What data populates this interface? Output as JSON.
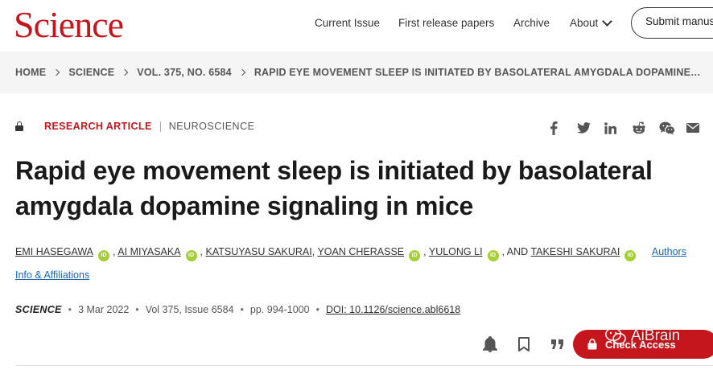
{
  "header": {
    "logo": "Science",
    "nav": [
      "Current Issue",
      "First release papers",
      "Archive",
      "About"
    ],
    "submit_label": "Submit manus"
  },
  "breadcrumb": [
    "HOME",
    "SCIENCE",
    "VOL. 375, NO. 6584",
    "RAPID EYE MOVEMENT SLEEP IS INITIATED BY BASOLATERAL AMYGDALA DOPAMINE…"
  ],
  "article": {
    "type": "RESEARCH ARTICLE",
    "subject": "NEUROSCIENCE",
    "title_line1": "Rapid eye movement sleep is initiated by basolateral",
    "title_line2": "amygdala dopamine signaling in mice",
    "authors": [
      "EMI HASEGAWA",
      "AI MIYASAKA",
      "KATSUYASU SAKURAI",
      "YOAN CHERASSE",
      "YULONG LI",
      "TAKESHI SAKURAI"
    ],
    "author_and": ", AND",
    "orcid_label": "iD",
    "affiliations_link": "Authors Info & Affiliations"
  },
  "citation": {
    "journal": "SCIENCE",
    "date": "3 Mar 2022",
    "volume": "Vol 375, Issue 6584",
    "pages": "pp. 994-1000",
    "doi": "DOI: 10.1126/science.abl6618",
    "separator": "•"
  },
  "access_button_label": "Check Access",
  "watermark": "AiBrain",
  "colors": {
    "brand_red": "#c4161c",
    "link_blue": "#1b65b5",
    "orcid_green": "#a6ce39",
    "breadcrumb_bg": "#f5f5f5"
  },
  "icons": [
    "lock-icon",
    "facebook-icon",
    "twitter-icon",
    "linkedin-icon",
    "reddit-icon",
    "wechat-icon",
    "email-icon",
    "bell-icon",
    "bookmark-icon",
    "quote-icon",
    "wechat-watermark-icon"
  ]
}
